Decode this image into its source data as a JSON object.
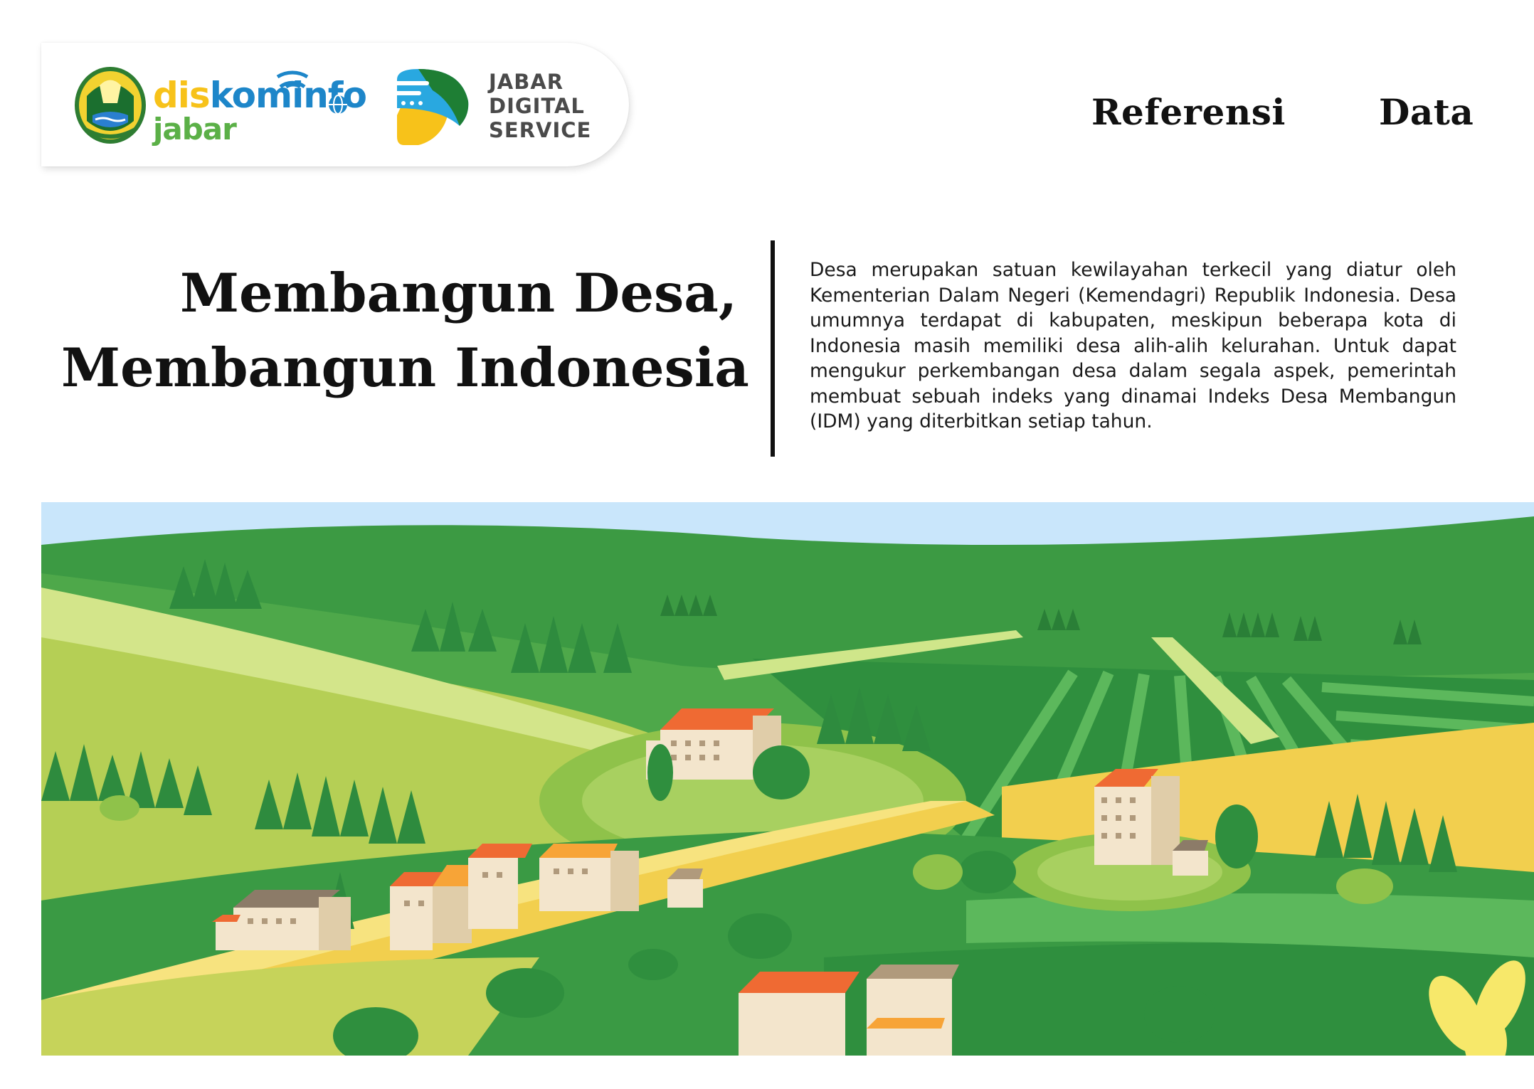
{
  "header": {
    "logos": {
      "diskominfo_text": [
        "dis",
        "kominf",
        "o",
        "jabar"
      ],
      "jds_text": [
        "JABAR",
        "DIGITAL",
        "SERVICE"
      ]
    },
    "nav": [
      {
        "label": "Referensi"
      },
      {
        "label": "Data"
      }
    ]
  },
  "hero": {
    "title_line1": "Membangun Desa,",
    "title_line2": "Membangun Indonesia",
    "description": "Desa merupakan satuan kewilayahan terkecil yang diatur oleh Kementerian Dalam Negeri (Kemendagri) Republik Indonesia. Desa umumnya terdapat di kabupaten, meskipun beberapa kota di Indonesia masih memiliki desa alih-alih kelurahan. Untuk dapat mengukur perkembangan desa dalam segala aspek, pemerintah membuat sebuah indeks yang dinamai Indeks Desa Membangun (IDM) yang diterbitkan setiap tahun."
  },
  "colors": {
    "sky": "#c9e6fb",
    "hill_dark": "#2f8f3e",
    "hill_light": "#b5cf55",
    "field_yellow": "#f2cf4e",
    "roof_orange": "#ef6a33",
    "building": "#f3e5cc",
    "logo_yellow": "#f7c21a",
    "logo_blue": "#1d86c9",
    "logo_green": "#5bb047"
  }
}
